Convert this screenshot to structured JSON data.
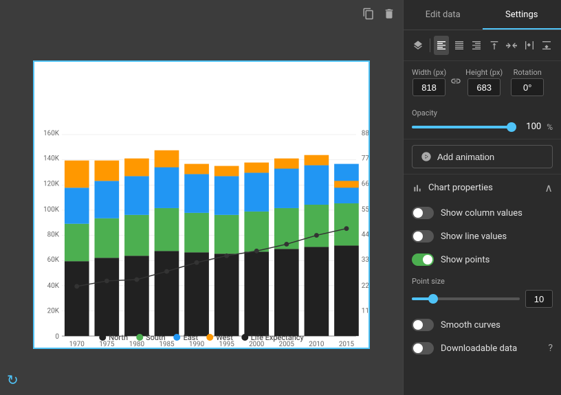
{
  "tabs": {
    "edit_data": "Edit data",
    "settings": "Settings"
  },
  "active_tab": "settings",
  "toolbar": {
    "icons": [
      "layers",
      "align-left",
      "align-center-h",
      "align-right",
      "align-top",
      "align-center-v",
      "align-bottom",
      "align-stretch"
    ]
  },
  "dimensions": {
    "width_label": "Width (px)",
    "height_label": "Height (px)",
    "rotation_label": "Rotation",
    "width_value": "818",
    "height_value": "683",
    "rotation_value": "0°"
  },
  "opacity": {
    "label": "Opacity",
    "value": "100",
    "percent": "%"
  },
  "add_animation": {
    "label": "Add animation"
  },
  "chart_properties": {
    "label": "Chart properties",
    "show_column_values": "Show column values",
    "show_line_values": "Show line values",
    "show_points": "Show points",
    "point_size_label": "Point size",
    "point_size_value": "10",
    "smooth_curves": "Smooth curves",
    "downloadable_data": "Downloadable data"
  },
  "legend": {
    "items": [
      {
        "label": "North",
        "color": "#212121"
      },
      {
        "label": "South",
        "color": "#4caf50"
      },
      {
        "label": "East",
        "color": "#2196f3"
      },
      {
        "label": "West",
        "color": "#ff9800"
      },
      {
        "label": "Life Expectancy",
        "color": "#212121",
        "type": "line"
      }
    ]
  },
  "chart": {
    "y_labels": [
      "160K",
      "140K",
      "120K",
      "100K",
      "80K",
      "60K",
      "40K",
      "20K",
      "0"
    ],
    "y2_labels": [
      "88",
      "77",
      "66",
      "55",
      "44",
      "33",
      "22",
      "11"
    ],
    "x_labels": [
      "1970",
      "1975",
      "1980",
      "1985",
      "1990",
      "1995",
      "2000",
      "2005",
      "2010",
      "2015"
    ]
  },
  "icons": {
    "copy": "⧉",
    "delete": "🗑",
    "refresh": "↻",
    "animation": "✦",
    "chart": "📊",
    "link": "🔗",
    "chevron_up": "∧",
    "help": "?"
  }
}
